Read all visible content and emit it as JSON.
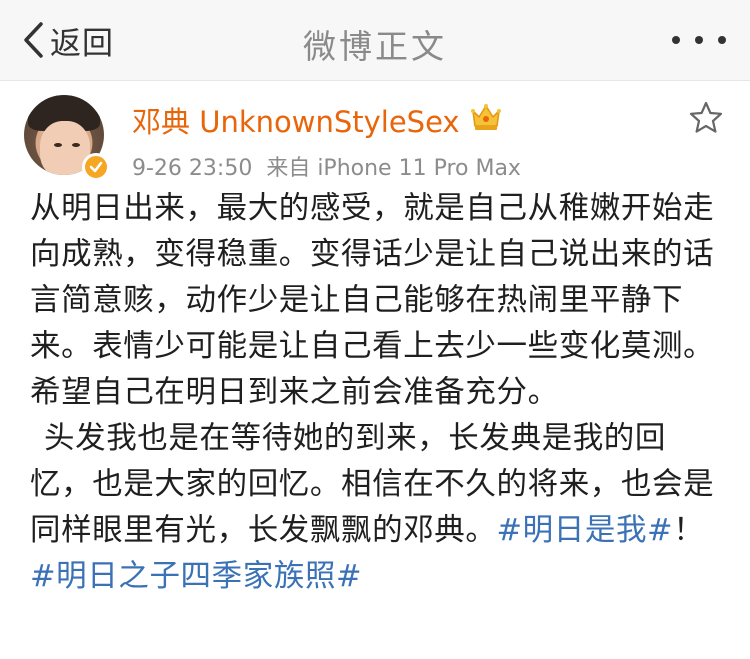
{
  "navbar": {
    "back_label": "返回",
    "title": "微博正文"
  },
  "post": {
    "username": "邓典 UnknownStyleSex",
    "timestamp": "9-26 23:50",
    "source": "来自 iPhone 11 Pro Max",
    "paragraph1": "从明日出来，最大的感受，就是自己从稚嫩开始走向成熟，变得稳重。变得话少是让自己说出来的话言简意赅，动作少是让自己能够在热闹里平静下来。表情少可能是让自己看上去少一些变化莫测。希望自己在明日到来之前会准备充分。",
    "paragraph2_text": "头发我也是在等待她的到来，长发典是我的回忆，也是大家的回忆。相信在不久的将来，也会是同样眼里有光，长发飘飘的邓典。",
    "hashtag1": "#明日是我#",
    "exclaim": "！",
    "hashtag2": "#明日之子四季家族照#"
  },
  "icons": {
    "back": "chevron-left-icon",
    "more": "more-dots-icon",
    "verified": "verified-badge-icon",
    "crown": "crown-icon",
    "favorite": "star-outline-icon"
  },
  "colors": {
    "username": "#e8650a",
    "hashtag": "#3b72b6",
    "verified_badge": "#f5a623",
    "nav_background": "#f7f7f7"
  }
}
